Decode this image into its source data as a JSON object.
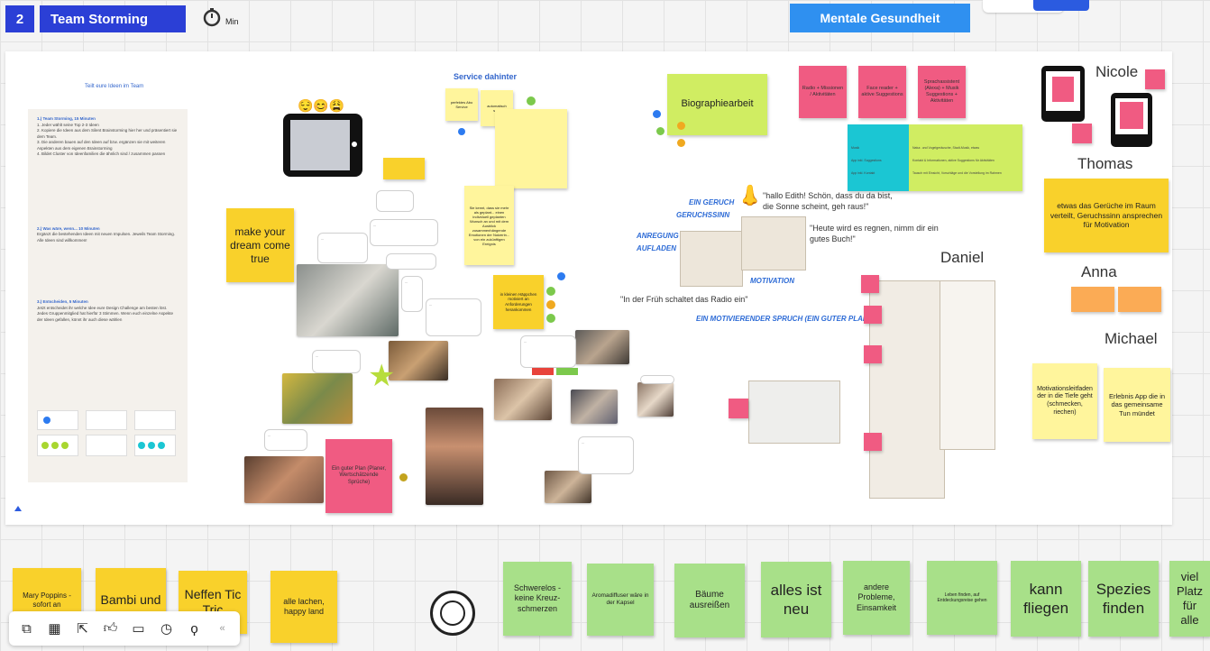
{
  "header": {
    "frame_number": "2",
    "frame_title": "Team Storming",
    "timer_label": "Min",
    "category_title": "Mentale Gesundheit"
  },
  "instructions": {
    "heading": "Teilt eure Ideen im Team",
    "section1_title": "1.) Team Storming, 15 Minuten",
    "section1_items": [
      "1. Jeder wählt seine Top 2-3 Ideen",
      "2. Kopiere die Ideen aus dem Silent Brainstorming hier her und präsentiert sie dem Team.",
      "3. Die anderen bauen auf den Ideen auf bzw. ergänzen sie mit weiteren Aspekten aus dem eigenen Brainstorming",
      "4. Bildet Cluster von Ideenfamilien die ähnlich sind / zusammen passen"
    ],
    "section2_title": "2.) Was wäre, wenn... 10 Minuten",
    "section2_text": "Ergänzt die bestehenden Ideen mit neuen Impulsen. Jeweils Team Storming. Alle Ideen sind willkommen!",
    "section3_title": "3.) Entscheiden, 5 Minuten",
    "section3_text": "Jetzt entscheidet ihr welche Idee eure Design Challenge am besten löst. Jedes Gruppenmitglied hat hierfür 3 Stimmen. Wenn euch einzelne Aspekte der Ideen gefallen, könnt ihr auch diese wählen"
  },
  "board": {
    "make_your_dream": "make your dream come true",
    "service_heading": "Service dahinter",
    "biographiearbeit": "Biographiearbeit",
    "ein_guter_plan": "Ein guter Plan (Planer, Wertschätzende Sprüche)",
    "kleine_haeppchen": "in kleinen Häppchen motiviert an Anforderungen herankommen",
    "yellow_long_note": "Sie kennt, dass sie mehr als geplant... einen individuell geplanten Wunsch an und mit dem Ausblick zusammenhängende Emotionen der Nutzerin... von ein zukünftigen Ereignis",
    "pink_notes": [
      "Radio + Missionen / Aktivitäten",
      "Face reader + aktive Suggestions",
      "Sprachassistent (Alexa) + Musik Suggestions + Aktivitäten"
    ],
    "gerueche": "etwas das Gerüche im Raum verteilt, Geruchssinn ansprechen für Motivation",
    "motivationsleitfaden": "Motivationsleitfaden der in die Tiefe geht (schmecken, riechen)",
    "erlebnis_app": "Erlebnis App die in das gemeinsame Tun mündet",
    "small_yellow_1": "perfektes Abo Service",
    "small_yellow_2": "automatisch sehr",
    "quote_1": "\"hallo Edith! Schön, dass du da bist, die Sonne scheint, geh raus!\"",
    "quote_2": "\"Heute wird es regnen, nimm dir ein gutes Buch!\"",
    "quote_3": "\"In der Früh schaltet das Radio ein\"",
    "label_duft": "EIN GERUCH",
    "label_geruch": "GERUCHSSINN",
    "label_anregung": "ANREGUNG",
    "label_aufladen": "AUFLADEN",
    "label_motivation": "MOTIVATION",
    "label_sprache": "EIN MOTIVIERENDER SPRUCH (EIN GUTER PLAN)",
    "names": [
      "Nicole",
      "Thomas",
      "Anna",
      "Michael",
      "Daniel"
    ],
    "table_rows": [
      [
        "Musik",
        "Natur- und Vogelgeräusche, Stadt-Musik, etwas"
      ],
      [
        "App inkl. Suggestions",
        "Kontakt & Informationen, aktive Suggestions für Aktivitäten"
      ],
      [
        "App inkl. Kontakt",
        "Tausch mit Einsicht, Vorschläge und die Vorstellung im Rahmen"
      ]
    ]
  },
  "bottom_notes": [
    "Mary Poppins - sofort an",
    "Bambi und",
    "Neffen Tic Tric",
    "alle lachen, happy land",
    "Schwerelos - keine Kreuz-schmerzen",
    "Aromadiffuser wäre in der Kapsel",
    "Bäume ausreißen",
    "alles ist neu",
    "andere Probleme, Einsamkeit",
    "Leben finden, auf Entdeckungsreise gehen",
    "kann fliegen",
    "Spezies finden",
    "viel Platz für alle"
  ],
  "toolbar": {
    "collapse": "«"
  },
  "colors": {
    "frame_blue": "#2b3fd6",
    "category_blue": "#2f90f0",
    "sticky_yellow": "#f9d12b",
    "sticky_green": "#a8e089",
    "sticky_pink": "#f05b82"
  }
}
